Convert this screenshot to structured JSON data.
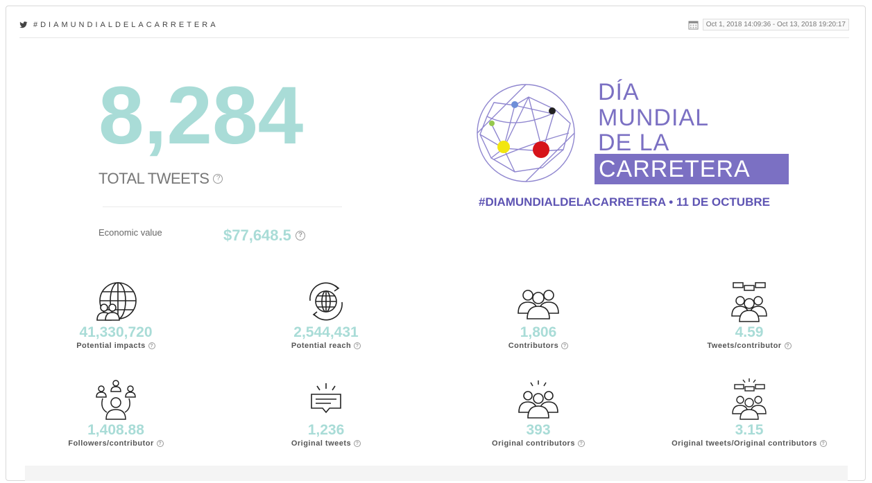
{
  "header": {
    "hashtag_title": "#DIAMUNDIALDELACARRETERA",
    "date_range": "Oct 1, 2018 14:09:36 - Oct 13, 2018 19:20:17"
  },
  "summary": {
    "total_tweets": "8,284",
    "total_tweets_label": "TOTAL TWEETS",
    "economic_value_label": "Economic value",
    "economic_value": "$77,648.5"
  },
  "banner": {
    "line1": "DÍA",
    "line2": "MUNDIAL",
    "line3": "DE LA",
    "line4": "CARRETERA",
    "hashtag": "#DIAMUNDIALDELACARRETERA  •  11 DE OCTUBRE"
  },
  "stats": [
    {
      "value": "41,330,720",
      "label": "Potential impacts",
      "icon": "globe-people-icon"
    },
    {
      "value": "2,544,431",
      "label": "Potential reach",
      "icon": "globe-refresh-icon"
    },
    {
      "value": "1,806",
      "label": "Contributors",
      "icon": "people-group-icon"
    },
    {
      "value": "4.59",
      "label": "Tweets/contributor",
      "icon": "people-chat-icon"
    },
    {
      "value": "1,408.88",
      "label": "Followers/contributor",
      "icon": "people-network-icon"
    },
    {
      "value": "1,236",
      "label": "Original tweets",
      "icon": "message-spark-icon"
    },
    {
      "value": "393",
      "label": "Original contributors",
      "icon": "people-spark-icon"
    },
    {
      "value": "3.15",
      "label": "Original tweets/Original contributors",
      "icon": "people-chat-spark-icon"
    }
  ],
  "help_glyph": "?",
  "colors": {
    "accent": "#a9dcd7",
    "brand": "#7b70c3",
    "brand_dark": "#5e54b3"
  }
}
